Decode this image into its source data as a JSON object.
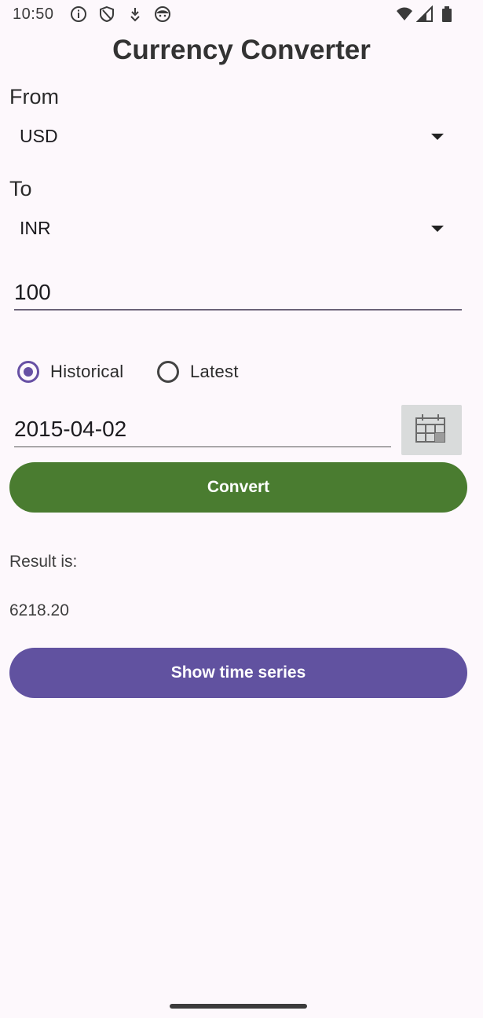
{
  "status_bar": {
    "time": "10:50",
    "left_icons": [
      "info-icon",
      "shield-icon",
      "download-icon",
      "face-icon"
    ],
    "right_icons": [
      "wifi-icon",
      "signal-icon",
      "battery-icon"
    ]
  },
  "app": {
    "title": "Currency Converter"
  },
  "form": {
    "from_label": "From",
    "from_value": "USD",
    "to_label": "To",
    "to_value": "INR",
    "amount": "100",
    "mode_options": [
      {
        "label": "Historical",
        "checked": true
      },
      {
        "label": "Latest",
        "checked": false
      }
    ],
    "date": "2015-04-02",
    "convert_label": "Convert"
  },
  "result": {
    "label": "Result is:",
    "value": "6218.20"
  },
  "actions": {
    "time_series_label": "Show time series"
  },
  "colors": {
    "background": "#fdf8fc",
    "convert_button": "#4a7c30",
    "series_button": "#6152a0",
    "accent": "#6750a4"
  }
}
